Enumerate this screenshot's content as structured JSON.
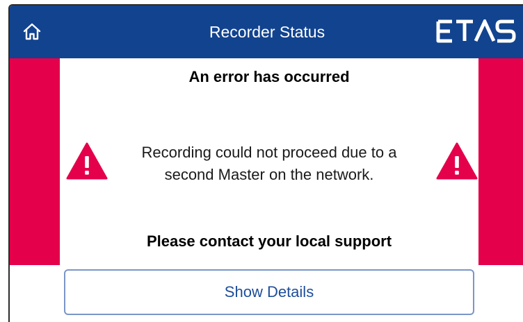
{
  "header": {
    "title": "Recorder Status",
    "home_icon": "home-icon",
    "logo_text": "ETAS",
    "background_color": "#12438f"
  },
  "error": {
    "heading": "An error has occurred",
    "message_line1": "Recording could not proceed due to a",
    "message_line2": "second Master on the network.",
    "support_text": "Please contact your local support",
    "warning_icon": "warning-triangle-icon",
    "accent_color": "#e4004b"
  },
  "actions": {
    "details_label": "Show Details"
  }
}
